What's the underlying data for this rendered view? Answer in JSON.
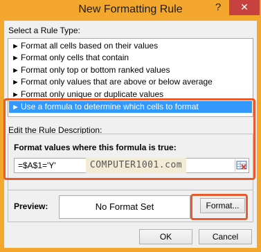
{
  "window": {
    "title": "New Formatting Rule",
    "help": "?",
    "close": "✕"
  },
  "rule_type": {
    "label": "Select a Rule Type:",
    "items": [
      {
        "text": "Format all cells based on their values"
      },
      {
        "text": "Format only cells that contain"
      },
      {
        "text": "Format only top or bottom ranked values"
      },
      {
        "text": "Format only values that are above or below average"
      },
      {
        "text": "Format only unique or duplicate values"
      },
      {
        "text": "Use a formula to determine which cells to format"
      }
    ],
    "selected_index": 5,
    "bullet": "►"
  },
  "description": {
    "label": "Edit the Rule Description:",
    "formula_label": "Format values where this formula is true:",
    "formula_value": "=$A$1='Y'",
    "watermark": "COMPUTER1001.com"
  },
  "preview": {
    "label": "Preview:",
    "text": "No Format Set",
    "format_button": "Format..."
  },
  "buttons": {
    "ok": "OK",
    "cancel": "Cancel"
  },
  "colors": {
    "frame": "#f3a72c",
    "selection": "#3399ff",
    "highlight": "#ea5a2a",
    "close": "#c7413f"
  }
}
